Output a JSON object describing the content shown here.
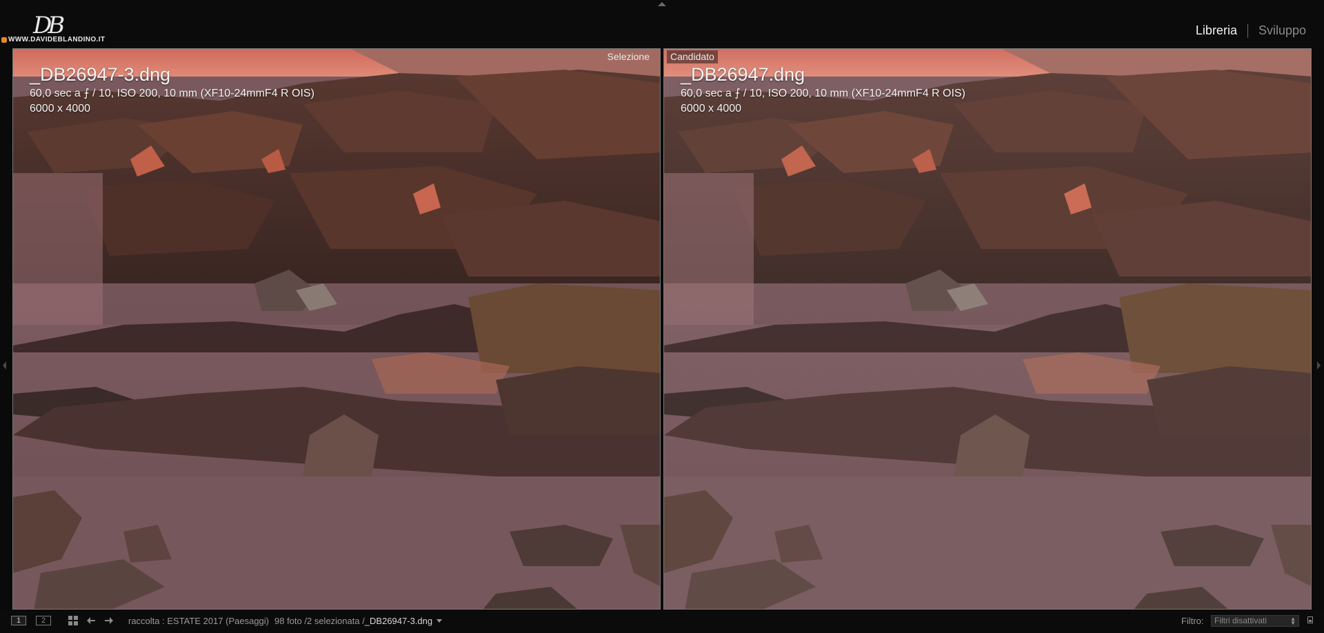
{
  "header": {
    "logo": {
      "monogram": "DB",
      "site": "WWW.DAVIDEBLANDINO.IT"
    },
    "modules": [
      {
        "label": "Libreria",
        "active": true
      },
      {
        "label": "Sviluppo",
        "active": false
      }
    ]
  },
  "compare": {
    "left": {
      "badge": "Selezione",
      "filename": "_DB26947-3.dng",
      "exif": "60,0 sec a ⨍ / 10, ISO 200, 10 mm (XF10-24mmF4 R OIS)",
      "dimensions": "6000 x 4000"
    },
    "right": {
      "badge": "Candidato",
      "filename": "_DB26947.dng",
      "exif": "60,0 sec a ⨍ / 10, ISO 200, 10 mm (XF10-24mmF4 R OIS)",
      "dimensions": "6000 x 4000"
    }
  },
  "filmstrip_bar": {
    "screen_primary": "1",
    "screen_secondary": "2",
    "collection": "raccolta : ESTATE 2017 (Paesaggi)",
    "selection_info": "98 foto /2 selezionata /",
    "selected_file": "_DB26947-3.dng",
    "filter_label": "Filtro:",
    "filter_value": "Filtri disattivati"
  },
  "colors": {
    "background": "#0a0a0a",
    "active_module": "#f2f2f2",
    "inactive_module": "#8a8a8a",
    "sky": "#d87868",
    "rock": "#4a2e28",
    "water": "#8a6a6e"
  },
  "icons": [
    "grid-view-icon",
    "previous-arrow-icon",
    "next-arrow-icon",
    "dropdown-caret-icon",
    "lock-icon"
  ]
}
